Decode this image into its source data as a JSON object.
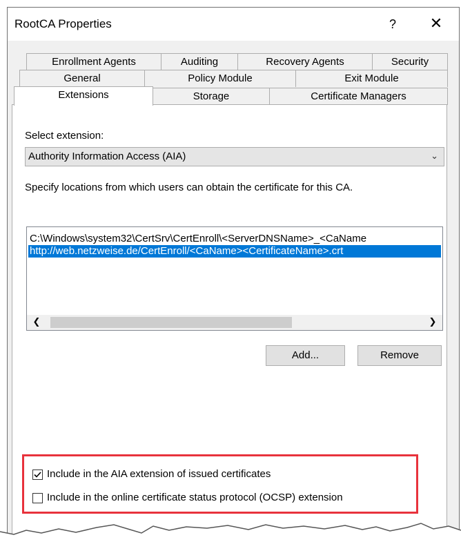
{
  "window": {
    "title": "RootCA Properties",
    "help_label": "?",
    "close_label": "✕"
  },
  "tabs": {
    "row1": [
      "Enrollment Agents",
      "Auditing",
      "Recovery Agents",
      "Security"
    ],
    "row2": [
      "General",
      "Policy Module",
      "Exit Module"
    ],
    "row3": [
      "Extensions",
      "Storage",
      "Certificate Managers"
    ],
    "active": "Extensions"
  },
  "extensions": {
    "select_label": "Select extension:",
    "selected_extension": "Authority Information Access (AIA)",
    "description": "Specify locations from which users can obtain the certificate for this CA.",
    "locations": [
      "C:\\Windows\\system32\\CertSrv\\CertEnroll\\<ServerDNSName>_<CaName",
      "http://web.netzweise.de/CertEnroll/<CaName><CertificateName>.crt"
    ],
    "selected_location_index": 1,
    "add_button": "Add...",
    "remove_button": "Remove",
    "options": [
      {
        "label": "Include in the AIA extension of issued certificates",
        "checked": true
      },
      {
        "label": "Include in the online certificate status protocol (OCSP) extension",
        "checked": false
      }
    ]
  },
  "colors": {
    "selection": "#0078d7",
    "highlight_border": "#e8323c"
  }
}
